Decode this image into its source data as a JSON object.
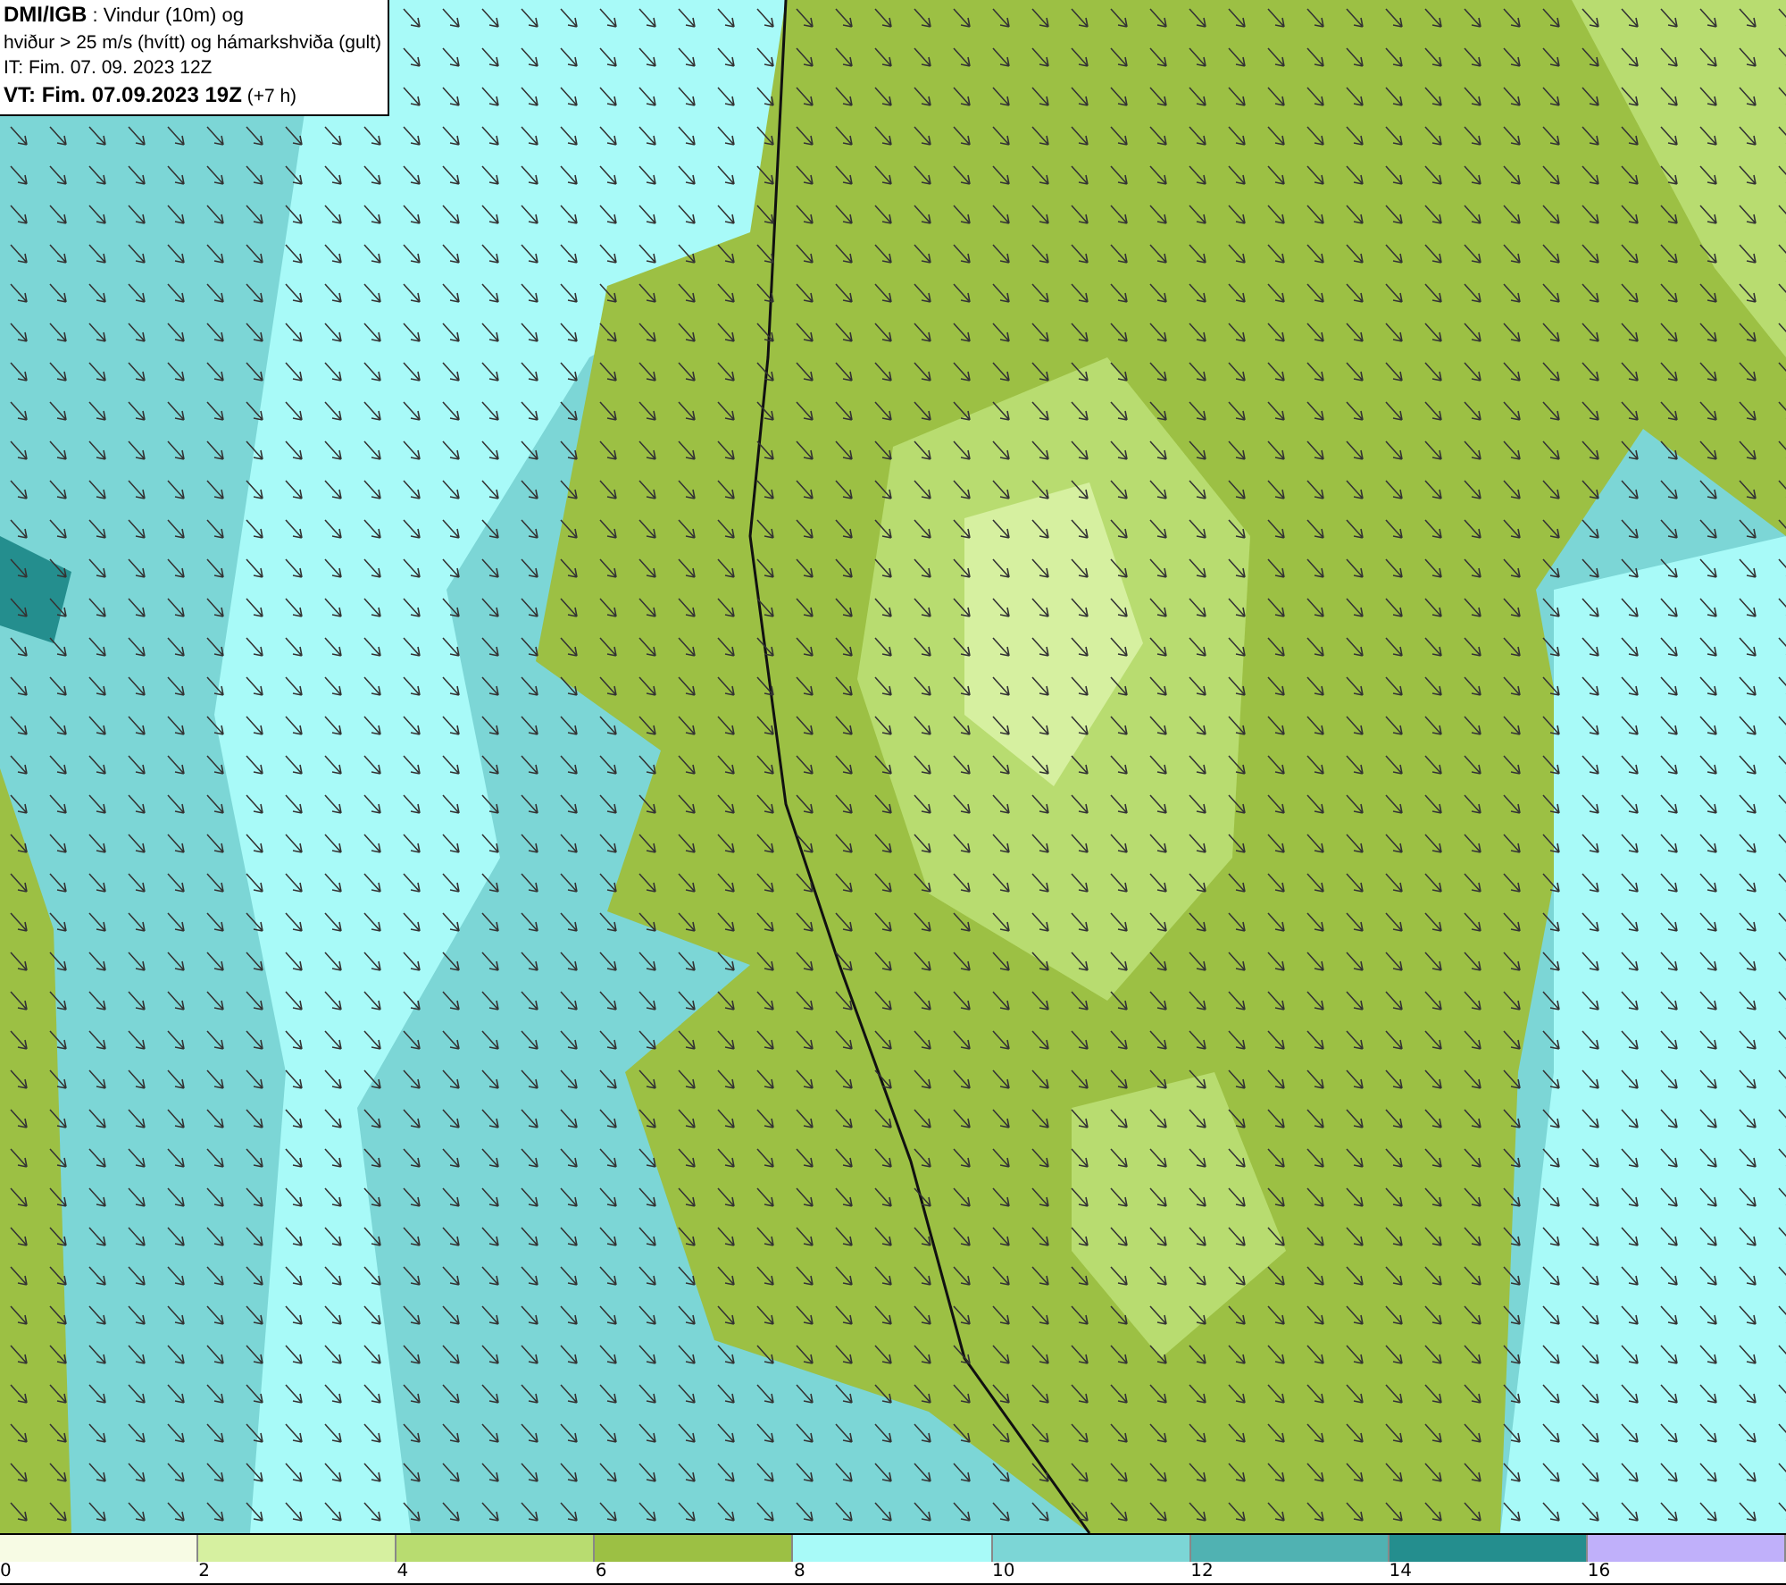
{
  "info_box": {
    "lines": [
      "**DMI/IGB** : Vindur (10m) og",
      "hviður > 25 m/s (hvítt) og hámarkshviða (gult)",
      "IT: Fim. 07. 09. 2023 12Z",
      "**VT: Fim. 07.09.2023 19Z** (+7 h)"
    ]
  },
  "legend": {
    "bins": [
      {
        "label": "0",
        "color": "#f7fbe4"
      },
      {
        "label": "2",
        "color": "#d6f0a0"
      },
      {
        "label": "4",
        "color": "#b8dc70"
      },
      {
        "label": "6",
        "color": "#9cc044"
      },
      {
        "label": "8",
        "color": "#a8faf8"
      },
      {
        "label": "10",
        "color": "#7cd6d6"
      },
      {
        "label": "12",
        "color": "#50b2b2"
      },
      {
        "label": "14",
        "color": "#248e8e"
      },
      {
        "label": "16",
        "color": "#c0b0fa"
      }
    ]
  }
}
